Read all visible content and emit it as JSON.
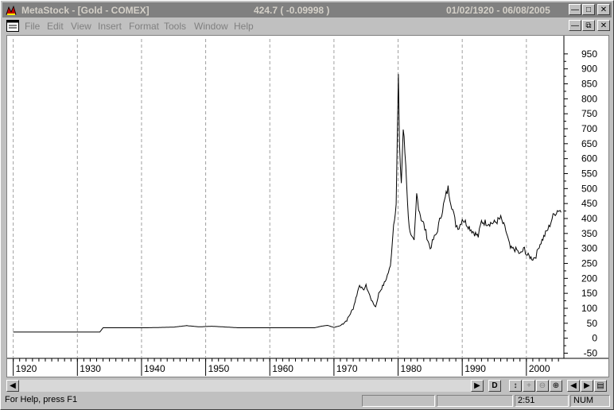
{
  "window": {
    "app_title": "MetaStock - [Gold - COMEX]",
    "readout": "424.7 ( -0.09998 )",
    "date_range": "01/02/1920 - 06/08/2005"
  },
  "menu": {
    "items": [
      {
        "label": "File"
      },
      {
        "label": "Edit"
      },
      {
        "label": "View"
      },
      {
        "label": "Insert"
      },
      {
        "label": "Format"
      },
      {
        "label": "Tools"
      },
      {
        "label": "Window"
      },
      {
        "label": "Help"
      }
    ]
  },
  "chart_data": {
    "type": "line",
    "title": "",
    "xlabel": "",
    "ylabel": "",
    "x_ticks": [
      "1920",
      "1930",
      "1940",
      "1950",
      "1960",
      "1970",
      "1980",
      "1990",
      "2000"
    ],
    "y_ticks": [
      "950",
      "900",
      "850",
      "800",
      "750",
      "700",
      "650",
      "600",
      "550",
      "500",
      "450",
      "400",
      "350",
      "300",
      "250",
      "200",
      "150",
      "100",
      "50",
      "0",
      "-50"
    ],
    "ylim": [
      -62,
      1000
    ],
    "xlim": [
      1919.3,
      2005.6
    ],
    "grid": "vertical dashed at x ticks",
    "series": [
      {
        "color": "#000000",
        "points": [
          [
            1920,
            20.67
          ],
          [
            1933.5,
            20.67
          ],
          [
            1934.0,
            35
          ],
          [
            1941,
            35
          ],
          [
            1945,
            37
          ],
          [
            1947,
            42
          ],
          [
            1949,
            38
          ],
          [
            1951,
            40
          ],
          [
            1955,
            35
          ],
          [
            1960,
            35
          ],
          [
            1967,
            35
          ],
          [
            1968,
            40
          ],
          [
            1969,
            43
          ],
          [
            1970,
            36
          ],
          [
            1971,
            42
          ],
          [
            1972,
            60
          ],
          [
            1973,
            100
          ],
          [
            1974,
            180
          ],
          [
            1974.5,
            160
          ],
          [
            1975,
            175
          ],
          [
            1976,
            120
          ],
          [
            1976.5,
            105
          ],
          [
            1977,
            150
          ],
          [
            1978,
            190
          ],
          [
            1978.8,
            240
          ],
          [
            1979.3,
            380
          ],
          [
            1979.7,
            450
          ],
          [
            1980.05,
            875
          ],
          [
            1980.2,
            640
          ],
          [
            1980.5,
            520
          ],
          [
            1980.8,
            700
          ],
          [
            1981.2,
            580
          ],
          [
            1981.6,
            400
          ],
          [
            1982.0,
            340
          ],
          [
            1982.5,
            320
          ],
          [
            1982.9,
            480
          ],
          [
            1983.2,
            440
          ],
          [
            1983.6,
            400
          ],
          [
            1984,
            380
          ],
          [
            1984.5,
            340
          ],
          [
            1985,
            300
          ],
          [
            1985.5,
            330
          ],
          [
            1986,
            350
          ],
          [
            1986.8,
            420
          ],
          [
            1987.5,
            480
          ],
          [
            1987.8,
            500
          ],
          [
            1988.5,
            430
          ],
          [
            1989,
            380
          ],
          [
            1989.5,
            370
          ],
          [
            1990,
            400
          ],
          [
            1990.8,
            380
          ],
          [
            1991.5,
            360
          ],
          [
            1992.5,
            340
          ],
          [
            1993,
            390
          ],
          [
            1994,
            385
          ],
          [
            1995,
            385
          ],
          [
            1996,
            400
          ],
          [
            1996.8,
            360
          ],
          [
            1997.5,
            300
          ],
          [
            1998.5,
            295
          ],
          [
            1999,
            280
          ],
          [
            1999.7,
            300
          ],
          [
            2000,
            280
          ],
          [
            2001,
            265
          ],
          [
            2001.5,
            275
          ],
          [
            2002,
            310
          ],
          [
            2003,
            350
          ],
          [
            2003.5,
            370
          ],
          [
            2004,
            400
          ],
          [
            2004.5,
            420
          ],
          [
            2005,
            430
          ],
          [
            2005.4,
            424.7
          ]
        ]
      }
    ]
  },
  "scroll": {
    "period_label": "D"
  },
  "status": {
    "help": "For Help, press F1",
    "time": "2:51",
    "num": "NUM"
  }
}
